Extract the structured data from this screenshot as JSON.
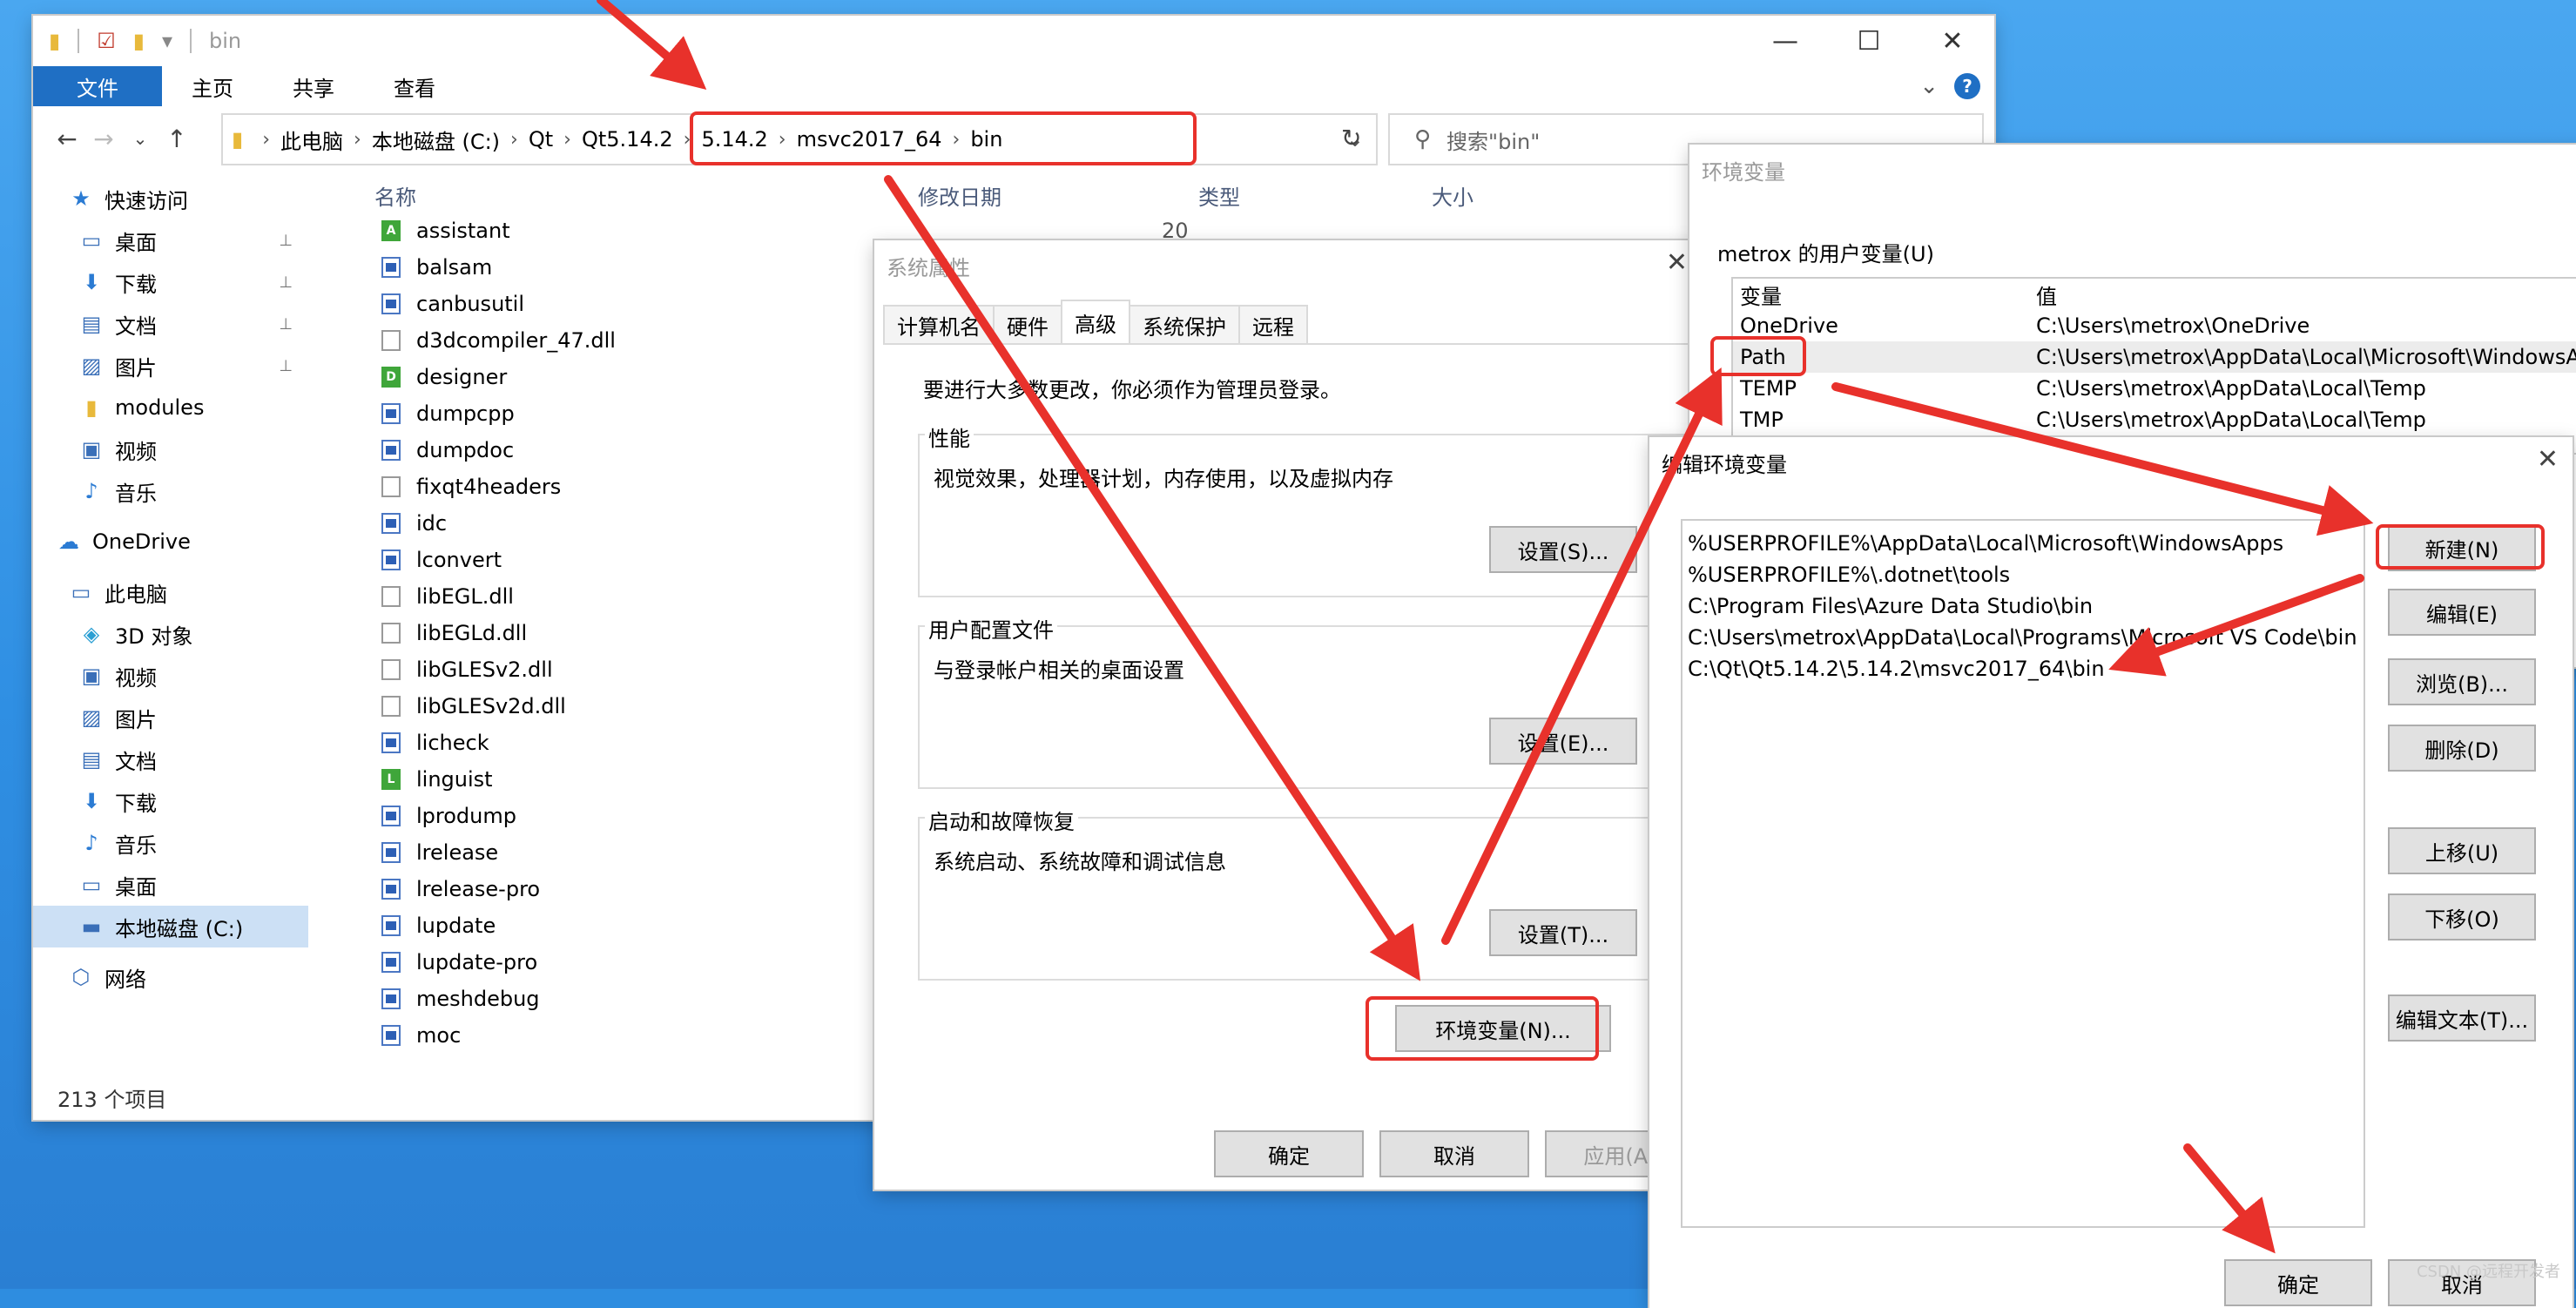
{
  "explorer": {
    "title": "bin",
    "ribbon_tabs": [
      "文件",
      "主页",
      "共享",
      "查看"
    ],
    "breadcrumb": [
      "此电脑",
      "本地磁盘 (C:)",
      "Qt",
      "Qt5.14.2",
      "5.14.2",
      "msvc2017_64",
      "bin"
    ],
    "search_placeholder": "搜索\"bin\"",
    "nav": [
      {
        "label": "快速访问",
        "icon": "star-icon"
      },
      {
        "label": "桌面",
        "icon": "desktop-icon"
      },
      {
        "label": "下载",
        "icon": "download-icon"
      },
      {
        "label": "文档",
        "icon": "document-icon"
      },
      {
        "label": "图片",
        "icon": "pictures-icon"
      },
      {
        "label": "modules",
        "icon": "folder-icon"
      },
      {
        "label": "视频",
        "icon": "video-icon"
      },
      {
        "label": "音乐",
        "icon": "music-icon"
      },
      {
        "label": "OneDrive",
        "icon": "cloud-icon"
      },
      {
        "label": "此电脑",
        "icon": "computer-icon"
      },
      {
        "label": "3D 对象",
        "icon": "cube-icon"
      },
      {
        "label": "视频",
        "icon": "video-icon"
      },
      {
        "label": "图片",
        "icon": "pictures-icon"
      },
      {
        "label": "文档",
        "icon": "document-icon"
      },
      {
        "label": "下载",
        "icon": "download-icon"
      },
      {
        "label": "音乐",
        "icon": "music-icon"
      },
      {
        "label": "桌面",
        "icon": "desktop-icon"
      },
      {
        "label": "本地磁盘 (C:)",
        "icon": "drive-icon"
      },
      {
        "label": "网络",
        "icon": "network-icon"
      }
    ],
    "columns": [
      "名称",
      "修改日期",
      "类型",
      "大小"
    ],
    "files": [
      {
        "name": "assistant",
        "kind": "green",
        "badge": "A"
      },
      {
        "name": "balsam",
        "kind": "exe"
      },
      {
        "name": "canbusutil",
        "kind": "exe"
      },
      {
        "name": "d3dcompiler_47.dll",
        "kind": "dll"
      },
      {
        "name": "designer",
        "kind": "green",
        "badge": "D"
      },
      {
        "name": "dumpcpp",
        "kind": "exe"
      },
      {
        "name": "dumpdoc",
        "kind": "exe"
      },
      {
        "name": "fixqt4headers",
        "kind": "dll"
      },
      {
        "name": "idc",
        "kind": "exe"
      },
      {
        "name": "lconvert",
        "kind": "exe"
      },
      {
        "name": "libEGL.dll",
        "kind": "dll"
      },
      {
        "name": "libEGLd.dll",
        "kind": "dll"
      },
      {
        "name": "libGLESv2.dll",
        "kind": "dll"
      },
      {
        "name": "libGLESv2d.dll",
        "kind": "dll"
      },
      {
        "name": "licheck",
        "kind": "exe"
      },
      {
        "name": "linguist",
        "kind": "green",
        "badge": "L"
      },
      {
        "name": "lprodump",
        "kind": "exe"
      },
      {
        "name": "lrelease",
        "kind": "exe"
      },
      {
        "name": "lrelease-pro",
        "kind": "exe"
      },
      {
        "name": "lupdate",
        "kind": "exe"
      },
      {
        "name": "lupdate-pro",
        "kind": "exe"
      },
      {
        "name": "meshdebug",
        "kind": "exe"
      },
      {
        "name": "moc",
        "kind": "exe"
      }
    ],
    "date_prefix": "20",
    "status": "213 个项目"
  },
  "sysprops": {
    "title": "系统属性",
    "tabs": [
      "计算机名",
      "硬件",
      "高级",
      "系统保护",
      "远程"
    ],
    "admin_note": "要进行大多数更改，你必须作为管理员登录。",
    "perf_title": "性能",
    "perf_desc": "视觉效果，处理器计划，内存使用，以及虚拟内存",
    "perf_btn": "设置(S)...",
    "profile_title": "用户配置文件",
    "profile_desc": "与登录帐户相关的桌面设置",
    "profile_btn": "设置(E)...",
    "startup_title": "启动和故障恢复",
    "startup_desc": "系统启动、系统故障和调试信息",
    "startup_btn": "设置(T)...",
    "env_btn": "环境变量(N)...",
    "ok": "确定",
    "cancel": "取消",
    "apply": "应用(A)"
  },
  "envvars": {
    "title": "环境变量",
    "user_section": "metrox 的用户变量(U)",
    "col_var": "变量",
    "col_val": "值",
    "rows": [
      {
        "name": "OneDrive",
        "value": "C:\\Users\\metrox\\OneDrive"
      },
      {
        "name": "Path",
        "value": "C:\\Users\\metrox\\AppData\\Local\\Microsoft\\WindowsAp"
      },
      {
        "name": "TEMP",
        "value": "C:\\Users\\metrox\\AppData\\Local\\Temp"
      },
      {
        "name": "TMP",
        "value": "C:\\Users\\metrox\\AppData\\Local\\Temp"
      }
    ]
  },
  "editenv": {
    "title": "编辑环境变量",
    "paths": [
      "%USERPROFILE%\\AppData\\Local\\Microsoft\\WindowsApps",
      "%USERPROFILE%\\.dotnet\\tools",
      "C:\\Program Files\\Azure Data Studio\\bin",
      "C:\\Users\\metrox\\AppData\\Local\\Programs\\Microsoft VS Code\\bin",
      "C:\\Qt\\Qt5.14.2\\5.14.2\\msvc2017_64\\bin"
    ],
    "buttons": [
      "新建(N)",
      "编辑(E)",
      "浏览(B)...",
      "删除(D)",
      "上移(U)",
      "下移(O)",
      "编辑文本(T)..."
    ],
    "ok": "确定",
    "cancel": "取消"
  },
  "watermark": "CSDN @远程开发者",
  "colors": {
    "annotation_red": "#e8312b",
    "accent_blue": "#1f6fc4"
  }
}
